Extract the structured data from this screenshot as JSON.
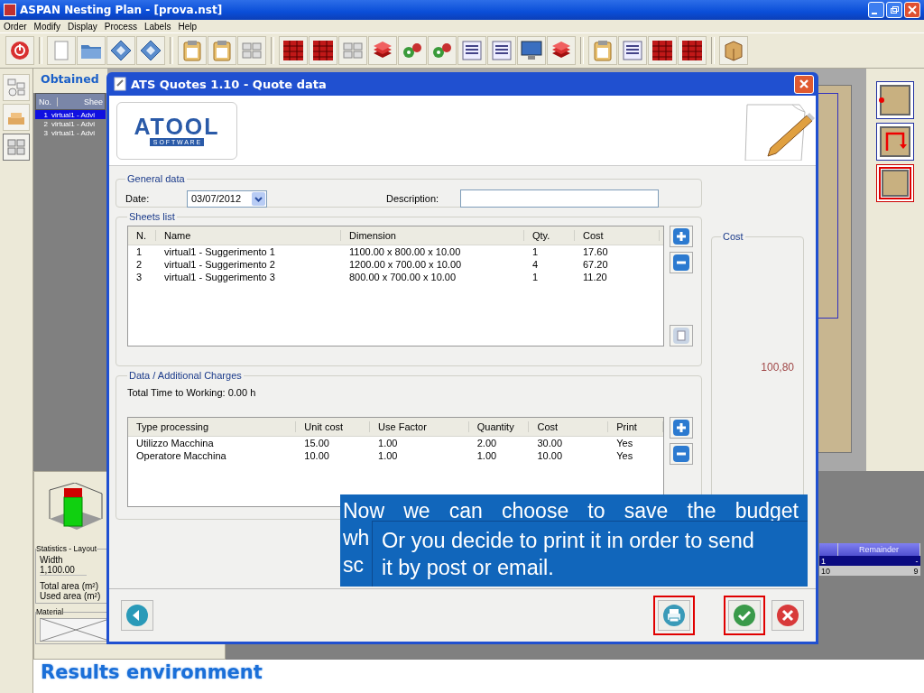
{
  "window": {
    "title": "ASPAN Nesting Plan - [prova.nst]"
  },
  "menu": [
    "Order",
    "Modify",
    "Display",
    "Process",
    "Labels",
    "Help"
  ],
  "results_panel": {
    "title": "Obtained",
    "columns": [
      "No.",
      "Shee"
    ],
    "rows": [
      {
        "no": "1",
        "sheet": "virtual1 - Advi",
        "selected": true
      },
      {
        "no": "2",
        "sheet": "virtual1 - Advi",
        "selected": false
      },
      {
        "no": "3",
        "sheet": "virtual1 - Advi",
        "selected": false
      }
    ]
  },
  "statistics": {
    "title": "Statistics - Layout",
    "width_label": "Width",
    "width_value": "1,100.00",
    "total_area_label": "Total area (m²)",
    "used_area_label": "Used area (m²)"
  },
  "material": {
    "title": "Material"
  },
  "remainder_table": {
    "columns": [
      "",
      "Remainder"
    ],
    "rows": [
      {
        "cells": [
          "1",
          "-"
        ],
        "selected": true
      },
      {
        "cells": [
          "10",
          "9"
        ],
        "selected": false
      }
    ]
  },
  "caption": "Results environment",
  "dialog": {
    "title": "ATS Quotes 1.10 - Quote data",
    "logo": {
      "name": "ATOOL",
      "tagline": "S O F T W A R E"
    },
    "general": {
      "title": "General data",
      "date_label": "Date:",
      "date_value": "03/07/2012",
      "description_label": "Description:"
    },
    "sheets": {
      "title": "Sheets list",
      "columns": [
        "N.",
        "Name",
        "Dimension",
        "Qty.",
        "Cost"
      ],
      "rows": [
        [
          "1",
          "virtual1 - Suggerimento 1",
          "1100.00 x 800.00 x 10.00",
          "1",
          "17.60"
        ],
        [
          "2",
          "virtual1 - Suggerimento 2",
          "1200.00 x 700.00 x 10.00",
          "4",
          "67.20"
        ],
        [
          "3",
          "virtual1 - Suggerimento 3",
          "800.00 x 700.00 x 10.00",
          "1",
          "11.20"
        ]
      ]
    },
    "charges": {
      "title": "Data / Additional Charges",
      "total_time": "Total Time to Working: 0.00 h",
      "columns": [
        "Type processing",
        "Unit cost",
        "Use Factor",
        "Quantity",
        "Cost",
        "Print"
      ],
      "rows": [
        [
          "Utilizzo Macchina",
          "15.00",
          "1.00",
          "2.00",
          "30.00",
          "Yes"
        ],
        [
          "Operatore Macchina",
          "10.00",
          "1.00",
          "1.00",
          "10.00",
          "Yes"
        ]
      ]
    },
    "cost": {
      "title": "Cost",
      "value": "100,80"
    },
    "footer_buttons": [
      {
        "kind": "back",
        "highlighted": false
      },
      {
        "kind": "print",
        "highlighted": true
      },
      {
        "kind": "confirm",
        "highlighted": true
      },
      {
        "kind": "cancel",
        "highlighted": false
      }
    ]
  },
  "callouts": [
    {
      "lines": [
        "Now we can choose to save the budget",
        "wh",
        "sc"
      ]
    },
    {
      "lines": [
        "Or you decide to print it in order to send",
        "it by post or email."
      ]
    }
  ]
}
